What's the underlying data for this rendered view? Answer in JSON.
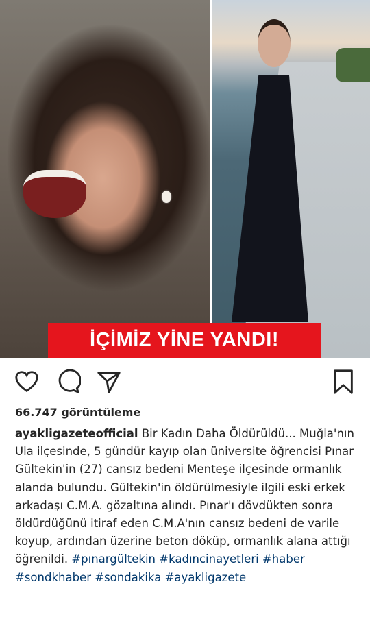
{
  "post": {
    "banner_text": "İÇİMİZ YİNE YANDI!",
    "views": "66.747 görüntüleme",
    "username": "ayakligazeteofficial",
    "caption_text": "Bir Kadın Daha Öldürüldü... Muğla'nın Ula ilçesinde, 5 gündür kayıp olan üniversite öğrencisi Pınar Gültekin'in (27) cansız bedeni Menteşe ilçesinde ormanlık alanda bulundu. Gültekin'in öldürülmesiyle ilgili eski erkek arkadaşı C.M.A. gözaltına alındı. Pınar'ı dövdükten sonra öldürdüğünü itiraf eden C.M.A'nın cansız bedeni de varile koyup, ardından üzerine beton döküp, ormanlık alana attığı öğrenildi.",
    "hashtags": [
      "#pınargültekin",
      "#kadıncinayetleri",
      "#haber",
      "#sondkhaber",
      "#sondakika",
      "#ayakligazete"
    ]
  },
  "icons": [
    "heart-icon",
    "comment-icon",
    "share-icon",
    "bookmark-icon"
  ]
}
